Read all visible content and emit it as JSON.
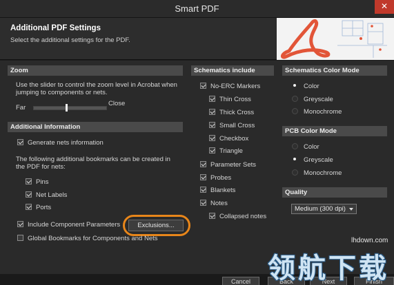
{
  "window": {
    "title": "Smart PDF",
    "close_label": "✕"
  },
  "header": {
    "title": "Additional PDF Settings",
    "subtitle": "Select the additional settings for the PDF."
  },
  "zoom": {
    "heading": "Zoom",
    "description_line1": "Use the slider to control the zoom level in Acrobat when",
    "description_line2": "jumping to components or nets.",
    "far_label": "Far",
    "close_label": "Close",
    "slider_level_fraction": 0.45
  },
  "additional": {
    "heading": "Additional Information",
    "generate_nets": {
      "label": "Generate nets information",
      "checked": true
    },
    "bookmarks_line1": "The following additional bookmarks can be created in",
    "bookmarks_line2": "the PDF for nets:",
    "items": [
      {
        "label": "Pins",
        "checked": true
      },
      {
        "label": "Net Labels",
        "checked": true
      },
      {
        "label": "Ports",
        "checked": true
      }
    ],
    "include_component": {
      "label": "Include Component Parameters",
      "checked": true
    },
    "exclusions_button": "Exclusions...",
    "global_bookmarks": {
      "label": "Global Bookmarks for Components and Nets",
      "checked": false
    }
  },
  "schematics_include": {
    "heading": "Schematics include",
    "no_erc": {
      "label": "No-ERC Markers",
      "checked": true
    },
    "no_erc_children": [
      {
        "label": "Thin Cross",
        "checked": true
      },
      {
        "label": "Thick Cross",
        "checked": true
      },
      {
        "label": "Small Cross",
        "checked": true
      },
      {
        "label": "Checkbox",
        "checked": true
      },
      {
        "label": "Triangle",
        "checked": true
      }
    ],
    "others": [
      {
        "label": "Parameter Sets",
        "checked": true
      },
      {
        "label": "Probes",
        "checked": true
      },
      {
        "label": "Blankets",
        "checked": true
      },
      {
        "label": "Notes",
        "checked": true
      }
    ],
    "collapsed_notes": {
      "label": "Collapsed notes",
      "checked": true
    }
  },
  "schematics_color": {
    "heading": "Schematics Color Mode",
    "options": [
      "Color",
      "Greyscale",
      "Monochrome"
    ],
    "selected": "Color"
  },
  "pcb_color": {
    "heading": "PCB Color Mode",
    "options": [
      "Color",
      "Greyscale",
      "Monochrome"
    ],
    "selected": "Greyscale"
  },
  "quality": {
    "heading": "Quality",
    "selected": "Medium (300 dpi)"
  },
  "footer": {
    "cancel": "Cancel",
    "back": "Back",
    "next": "Next",
    "finish": "Finish"
  },
  "watermark": {
    "site": "lhdown.com",
    "chars": "领航下载"
  },
  "colors": {
    "highlight_ring": "#e8861a",
    "section_header": "#4a4a4a",
    "close_button": "#c0392b"
  }
}
